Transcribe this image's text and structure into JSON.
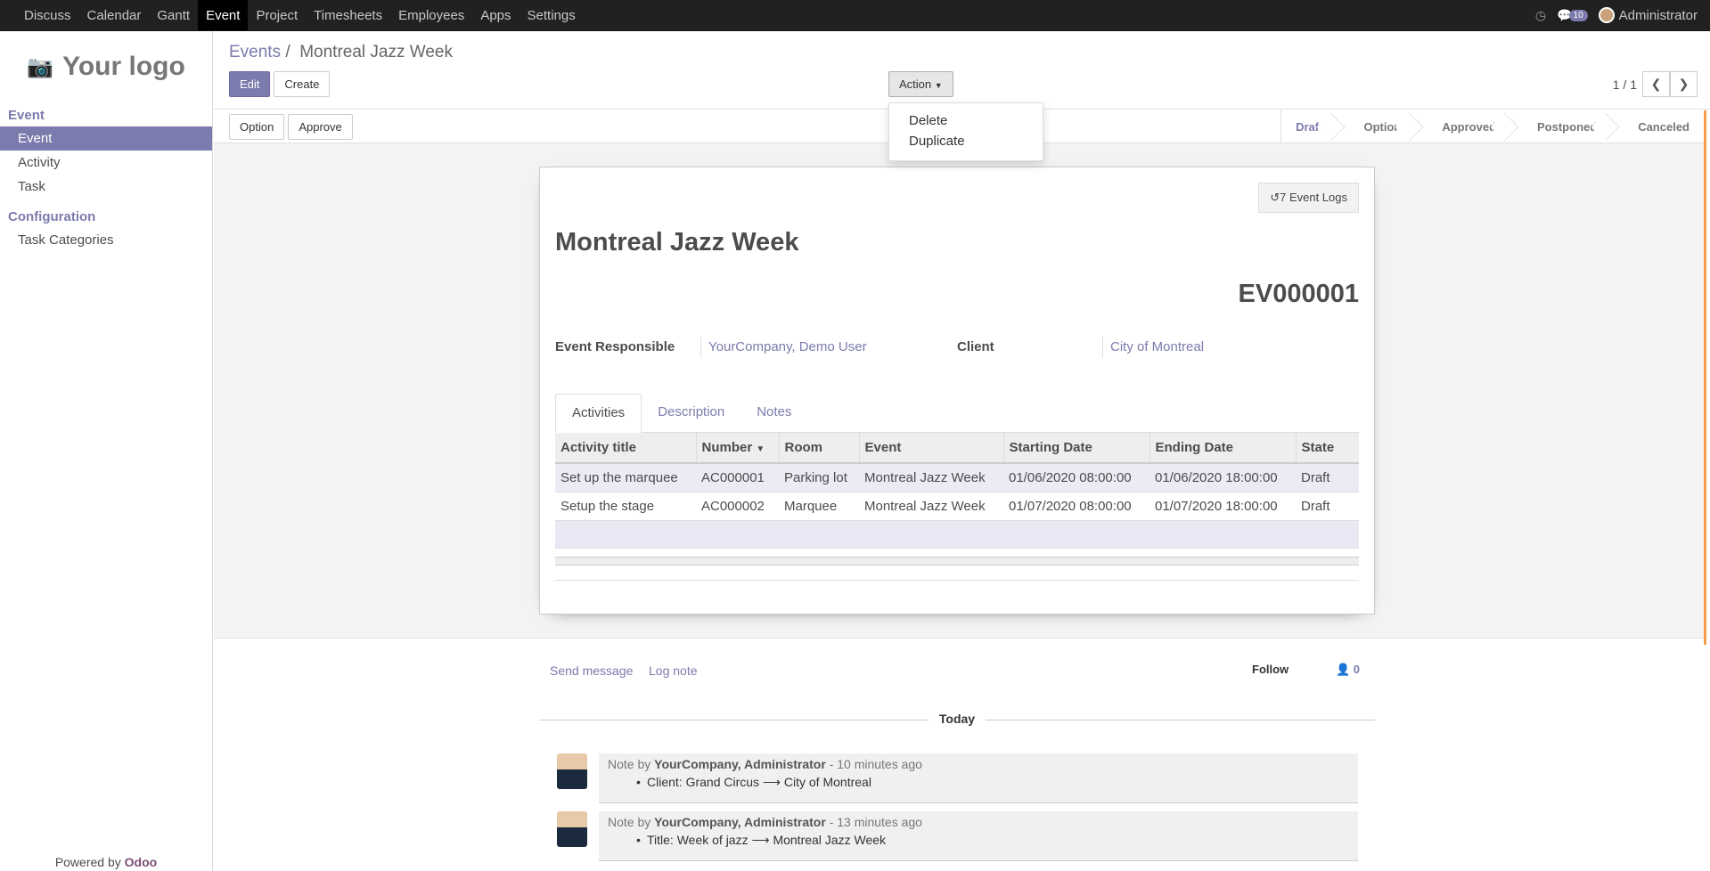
{
  "nav": {
    "items": [
      {
        "label": "Discuss"
      },
      {
        "label": "Calendar"
      },
      {
        "label": "Gantt"
      },
      {
        "label": "Event"
      },
      {
        "label": "Project"
      },
      {
        "label": "Timesheets"
      },
      {
        "label": "Employees"
      },
      {
        "label": "Apps"
      },
      {
        "label": "Settings"
      }
    ],
    "active": "Event",
    "messages_count": "10",
    "user": "Administrator"
  },
  "sidebar": {
    "logo_text": "Your logo",
    "section_event": "Event",
    "items_event": [
      {
        "label": "Event"
      },
      {
        "label": "Activity"
      },
      {
        "label": "Task"
      }
    ],
    "section_config": "Configuration",
    "items_config": [
      {
        "label": "Task Categories"
      }
    ],
    "powered_prefix": "Powered by",
    "powered_brand": "Odoo"
  },
  "control": {
    "breadcrumb_parent": "Events",
    "breadcrumb_sep": "/",
    "breadcrumb_current": "Montreal Jazz Week",
    "edit_label": "Edit",
    "create_label": "Create",
    "action_label": "Action",
    "pager": "1 / 1"
  },
  "action_menu": {
    "items": [
      {
        "label": "Delete"
      },
      {
        "label": "Duplicate"
      }
    ]
  },
  "statusbar": {
    "option_label": "Option",
    "approve_label": "Approve",
    "stages": [
      {
        "label": "Draft"
      },
      {
        "label": "Option"
      },
      {
        "label": "Approved"
      },
      {
        "label": "Postponed"
      },
      {
        "label": "Canceled"
      }
    ],
    "current_stage": "Draft"
  },
  "form": {
    "event_logs": "7 Event Logs",
    "title": "Montreal Jazz Week",
    "number": "EV000001",
    "responsible_label": "Event Responsible",
    "responsible_value": "YourCompany, Demo User",
    "client_label": "Client",
    "client_value": "City of Montreal",
    "tabs": [
      {
        "label": "Activities"
      },
      {
        "label": "Description"
      },
      {
        "label": "Notes"
      }
    ],
    "table": {
      "headers": [
        "Activity title",
        "Number",
        "Room",
        "Event",
        "Starting Date",
        "Ending Date",
        "State"
      ],
      "rows": [
        [
          "Set up the marquee",
          "AC000001",
          "Parking lot",
          "Montreal Jazz Week",
          "01/06/2020 08:00:00",
          "01/06/2020 18:00:00",
          "Draft"
        ],
        [
          "Setup the stage",
          "AC000002",
          "Marquee",
          "Montreal Jazz Week",
          "01/07/2020 08:00:00",
          "01/07/2020 18:00:00",
          "Draft"
        ]
      ]
    }
  },
  "chatter": {
    "send_message": "Send message",
    "log_note": "Log note",
    "follow": "Follow",
    "followers": "0",
    "day_label": "Today",
    "messages": [
      {
        "prefix": "Note by",
        "author": "YourCompany, Administrator",
        "time": "- 10 minutes ago",
        "body": "Client: Grand Circus ⟶ City of Montreal"
      },
      {
        "prefix": "Note by",
        "author": "YourCompany, Administrator",
        "time": "- 13 minutes ago",
        "body": "Title: Week of jazz ⟶ Montreal Jazz Week"
      }
    ]
  },
  "colors": {
    "brand": "#7c7bad",
    "navbar": "#212121",
    "accent_scroll": "#f39c4a"
  }
}
